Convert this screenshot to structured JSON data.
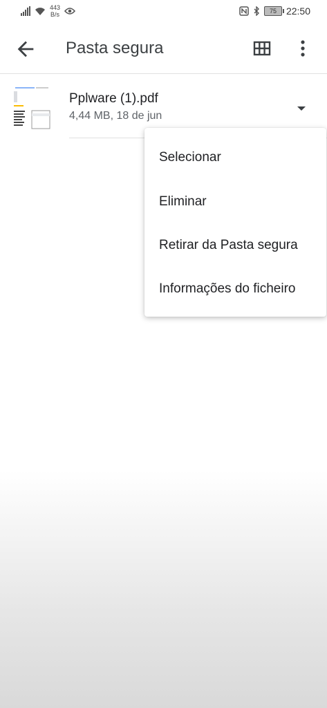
{
  "status_bar": {
    "net_speed_value": "443",
    "net_speed_unit": "B/s",
    "battery": "75",
    "time": "22:50"
  },
  "app_bar": {
    "title": "Pasta segura"
  },
  "file": {
    "name": "Pplware (1).pdf",
    "meta": "4,44 MB, 18 de jun"
  },
  "menu": {
    "items": [
      {
        "label": "Selecionar"
      },
      {
        "label": "Eliminar"
      },
      {
        "label": "Retirar da Pasta segura"
      },
      {
        "label": "Informações do ficheiro"
      }
    ]
  }
}
